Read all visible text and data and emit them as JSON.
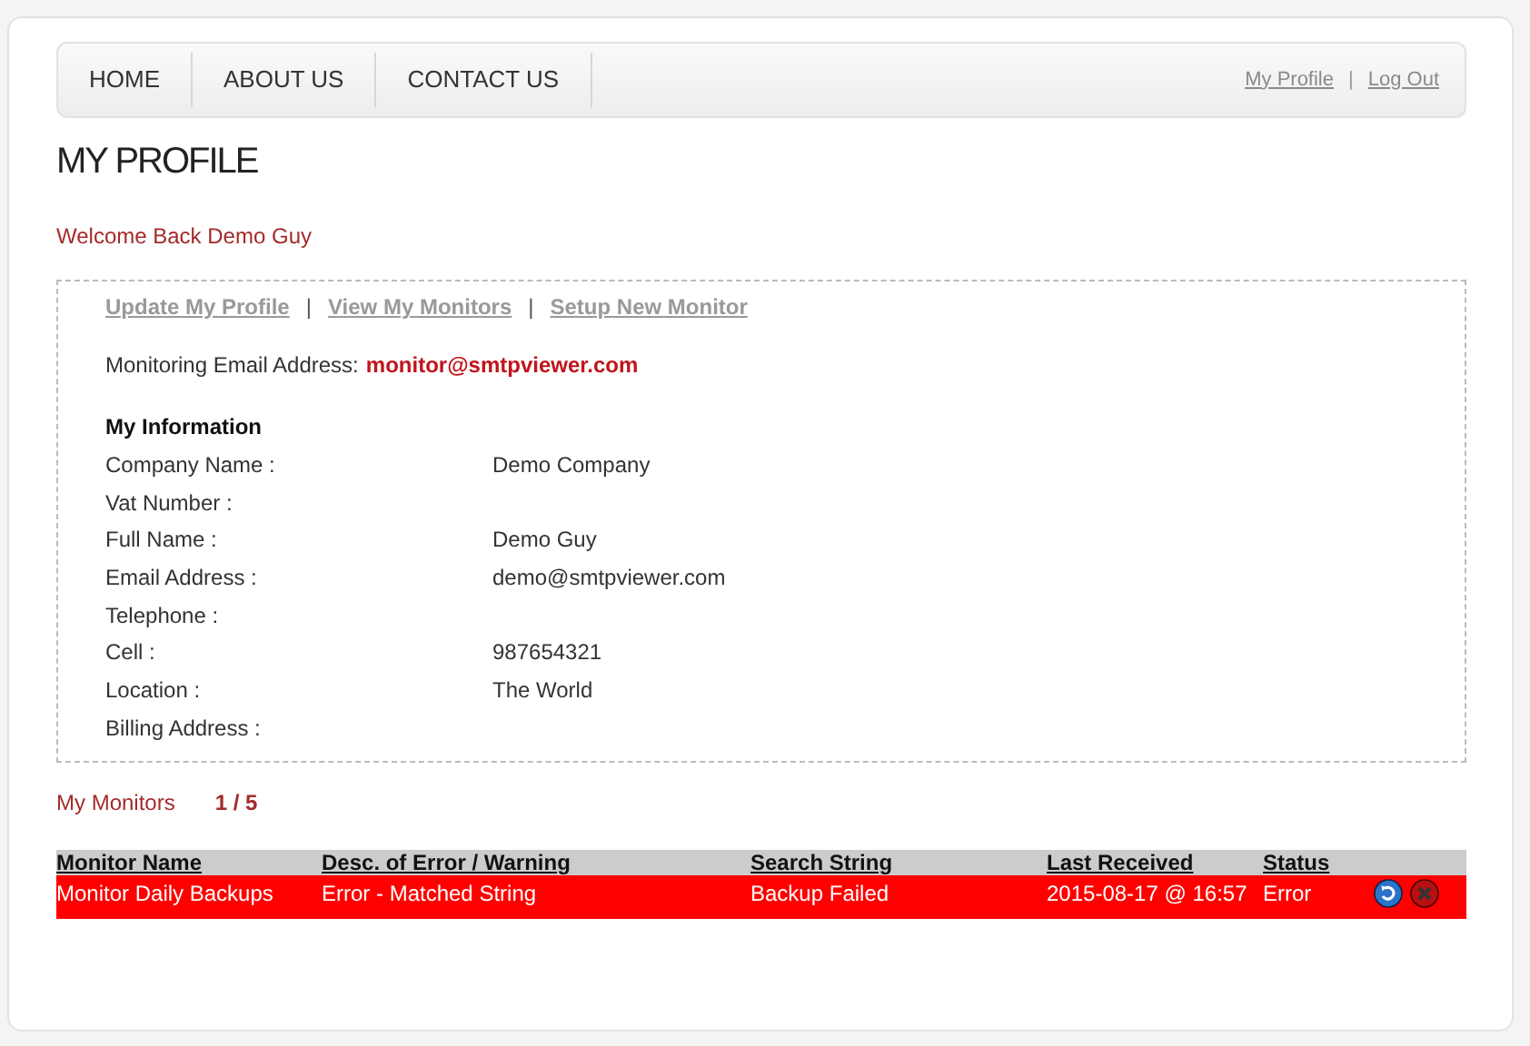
{
  "nav": {
    "items": [
      {
        "label": "HOME"
      },
      {
        "label": "ABOUT US"
      },
      {
        "label": "CONTACT US"
      }
    ],
    "links": [
      "My Profile",
      "Log Out"
    ],
    "separator": "|"
  },
  "page_title": "MY PROFILE",
  "welcome": "Welcome Back Demo Guy",
  "profile": {
    "links": [
      "Update My Profile",
      "View My Monitors",
      "Setup New Monitor"
    ],
    "separator": "|",
    "monitoring_email_label": "Monitoring Email Address:",
    "monitoring_email": "monitor@smtpviewer.com",
    "section_title": "My Information",
    "fields": [
      {
        "label": "Company Name :",
        "value": "Demo Company"
      },
      {
        "label": "Vat Number :"
      },
      {
        "label": "Full Name :",
        "value": "Demo Guy"
      },
      {
        "label": "Email Address :",
        "value": "demo@smtpviewer.com"
      },
      {
        "label": "Telephone :"
      },
      {
        "label": "Cell :",
        "value": "987654321"
      },
      {
        "label": "Location :",
        "value": "The World"
      },
      {
        "label": "Billing Address :"
      }
    ]
  },
  "monitors": {
    "title": "My Monitors",
    "count": "1 / 5",
    "table": {
      "columns": [
        "Monitor Name",
        "Desc. of Error / Warning",
        "Search String",
        "Last Received",
        "Status"
      ],
      "rows": [
        {
          "kind": "error",
          "cells": [
            "Monitor Daily Backups",
            "Error - Matched String",
            "Backup Failed",
            "2015-08-17 @ 16:57",
            "Error"
          ]
        }
      ]
    }
  }
}
